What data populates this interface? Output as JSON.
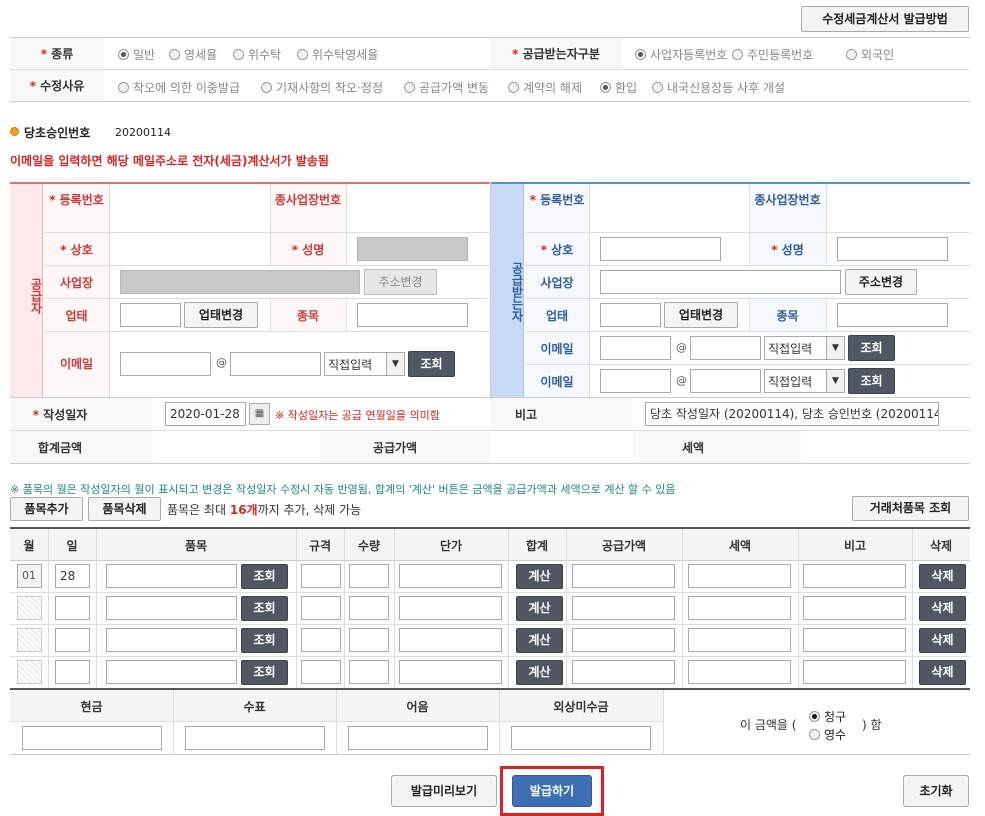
{
  "top": {
    "how_to_button": "수정세금계산서 발급방법"
  },
  "type_row": {
    "label": "종류",
    "options": [
      "일반",
      "영세율",
      "위수탁",
      "위수탁영세율"
    ],
    "selected": 0,
    "receiver_label": "공급받는자구분",
    "receiver_options": [
      "사업자등록번호",
      "주민등록번호",
      "외국인"
    ],
    "receiver_selected": 0
  },
  "reason_row": {
    "label": "수정사유",
    "options": [
      "착오에 의한 이중발급",
      "기재사항의 착오·정정",
      "공급가액 변동",
      "계약의 해제",
      "환입",
      "내국신용장등 사후 개설"
    ],
    "selected": 4
  },
  "original_approval": {
    "label": "당초승인번호",
    "value": "20200114"
  },
  "email_notice": "이메일을 입력하면 해당 메일주소로 전자(세금)계산서가 발송됨",
  "supplier": {
    "side_label": "공급자",
    "reg_no_label": "등록번호",
    "sub_biz_label": "종사업장번호",
    "company_label": "상호",
    "name_label": "성명",
    "address_label": "사업장",
    "address_button": "주소변경",
    "biz_type_label": "업태",
    "biz_type_button": "업태변경",
    "item_label": "종목",
    "email_label": "이메일",
    "email_at": "@",
    "email_select": "직접입력",
    "email_lookup": "조회"
  },
  "receiver": {
    "side_label": "공급받는자",
    "reg_no_label": "등록번호",
    "sub_biz_label": "종사업장번호",
    "company_label": "상호",
    "name_label": "성명",
    "address_label": "사업장",
    "address_button": "주소변경",
    "biz_type_label": "업태",
    "biz_type_button": "업태변경",
    "item_label": "종목",
    "email_label": "이메일",
    "email_label_2": "이메일",
    "email_at": "@",
    "email_select": "직접입력",
    "email_lookup": "조회"
  },
  "write_date": {
    "label": "작성일자",
    "value": "2020-01-28",
    "note": "※ 작성일자는 공급 연월일을 의미함",
    "memo_label": "비고",
    "memo_value": "당초 작성일자 (20200114), 당초 승인번호 (20200114-"
  },
  "totals": {
    "total_label": "합계금액",
    "supply_label": "공급가액",
    "tax_label": "세액"
  },
  "items_notice": "※ 품목의 월은 작성일자의 월이 표시되고 변경은 작성일자 수정시 자동 반영됨, 합계의 '계산' 버튼은 금액을 공급가액과 세액으로 계산 할 수 있음",
  "items_toolbar": {
    "add_button": "품목추가",
    "delete_button": "품목삭제",
    "limit_text_1": "품목은 최대",
    "limit_count": "16개",
    "limit_text_2": "까지 추가, 삭제 가능",
    "partner_items_button": "거래처품목 조회"
  },
  "items_table": {
    "headers": [
      "월",
      "일",
      "품목",
      "규격",
      "수량",
      "단가",
      "합계",
      "공급가액",
      "세액",
      "비고",
      "삭제"
    ],
    "rows": [
      {
        "month": "01",
        "day": "28",
        "lookup": "조회",
        "calc": "계산",
        "delete": "삭제"
      },
      {
        "month": "",
        "day": "",
        "lookup": "조회",
        "calc": "계산",
        "delete": "삭제"
      },
      {
        "month": "",
        "day": "",
        "lookup": "조회",
        "calc": "계산",
        "delete": "삭제"
      },
      {
        "month": "",
        "day": "",
        "lookup": "조회",
        "calc": "계산",
        "delete": "삭제"
      }
    ]
  },
  "payment": {
    "headers": [
      "현금",
      "수표",
      "어음",
      "외상미수금"
    ],
    "amount_text_1": "이 금액을 (",
    "amount_text_2": ") 함",
    "options": [
      "청구",
      "영수"
    ],
    "selected": 0
  },
  "bottom": {
    "preview_button": "발급미리보기",
    "issue_button": "발급하기",
    "reset_button": "초기화"
  },
  "colors": {
    "supplier_accent": "#e07070",
    "receiver_accent": "#5a8fd0",
    "issue_highlight": "#e02020",
    "issue_button": "#3c6fb4"
  }
}
